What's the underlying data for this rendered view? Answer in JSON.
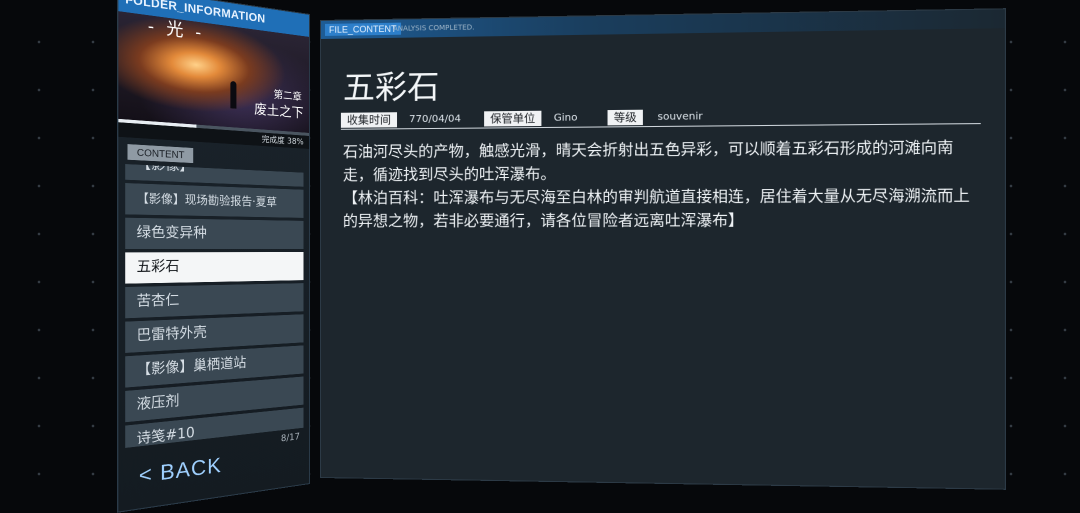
{
  "folder": {
    "header": "FOLDER_INFORMATION",
    "cover_glyph": "- 光 -",
    "chapter_number": "第二章",
    "chapter_title": "废土之下",
    "completion_label": "完成度 38%",
    "completion_percent": 38
  },
  "content_tab": "CONTENT",
  "list": {
    "items": [
      {
        "label": "【影像】",
        "partial": true
      },
      {
        "label": "【影像】现场勘验报告·夏草",
        "small": true
      },
      {
        "label": "绿色变异种"
      },
      {
        "label": "五彩石",
        "selected": true
      },
      {
        "label": "苦杏仁"
      },
      {
        "label": "巴雷特外壳"
      },
      {
        "label": "【影像】巢栖道站"
      },
      {
        "label": "液压剂"
      },
      {
        "label": "诗笺#10"
      }
    ],
    "pager": "8/17"
  },
  "back_label": "< BACK",
  "file": {
    "tab": "FILE_CONTENT",
    "status": "ANALYSIS COMPLETED.",
    "title": "五彩石",
    "meta": {
      "collected_label": "收集时间",
      "collected_value": "770/04/04",
      "custodian_label": "保管单位",
      "custodian_value": "Gino",
      "grade_label": "等级",
      "grade_value": "souvenir"
    },
    "paragraphs": [
      "石油河尽头的产物，触感光滑，晴天会折射出五色异彩，可以顺着五彩石形成的河滩向南走，循迹找到尽头的吐浑瀑布。",
      "【林泊百科：吐浑瀑布与无尽海至白林的审判航道直接相连，居住着大量从无尽海溯流而上的异想之物，若非必要通行，请各位冒险者远离吐浑瀑布】"
    ]
  },
  "colors": {
    "accent_blue": "#1f6fb7",
    "list_item_bg": "#3a4853",
    "selected_bg": "#f4f6f7",
    "panel_bg": "#1d262d"
  }
}
